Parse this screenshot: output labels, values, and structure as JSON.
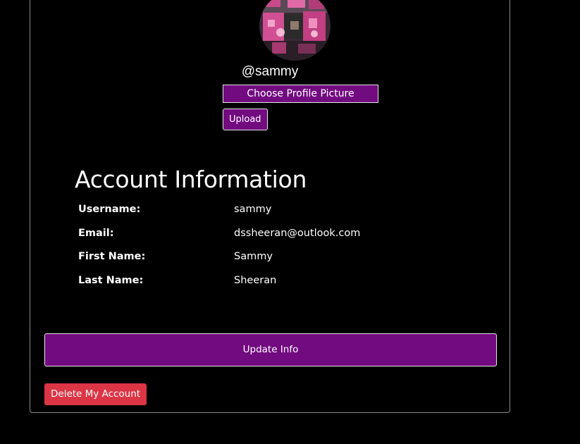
{
  "profile": {
    "handle": "@sammy",
    "choose_picture_label": "Choose Profile Picture",
    "upload_label": "Upload"
  },
  "account": {
    "title": "Account Information",
    "fields": [
      {
        "label": "Username:",
        "value": "sammy"
      },
      {
        "label": "Email:",
        "value": "dssheeran@outlook.com"
      },
      {
        "label": "First Name:",
        "value": "Sammy"
      },
      {
        "label": "Last Name:",
        "value": "Sheeran"
      }
    ]
  },
  "actions": {
    "update_label": "Update Info",
    "delete_label": "Delete My Account"
  },
  "colors": {
    "background": "#000000",
    "accent_purple": "#720a80",
    "danger_red": "#dc3545",
    "card_border": "#8a8a8a"
  }
}
